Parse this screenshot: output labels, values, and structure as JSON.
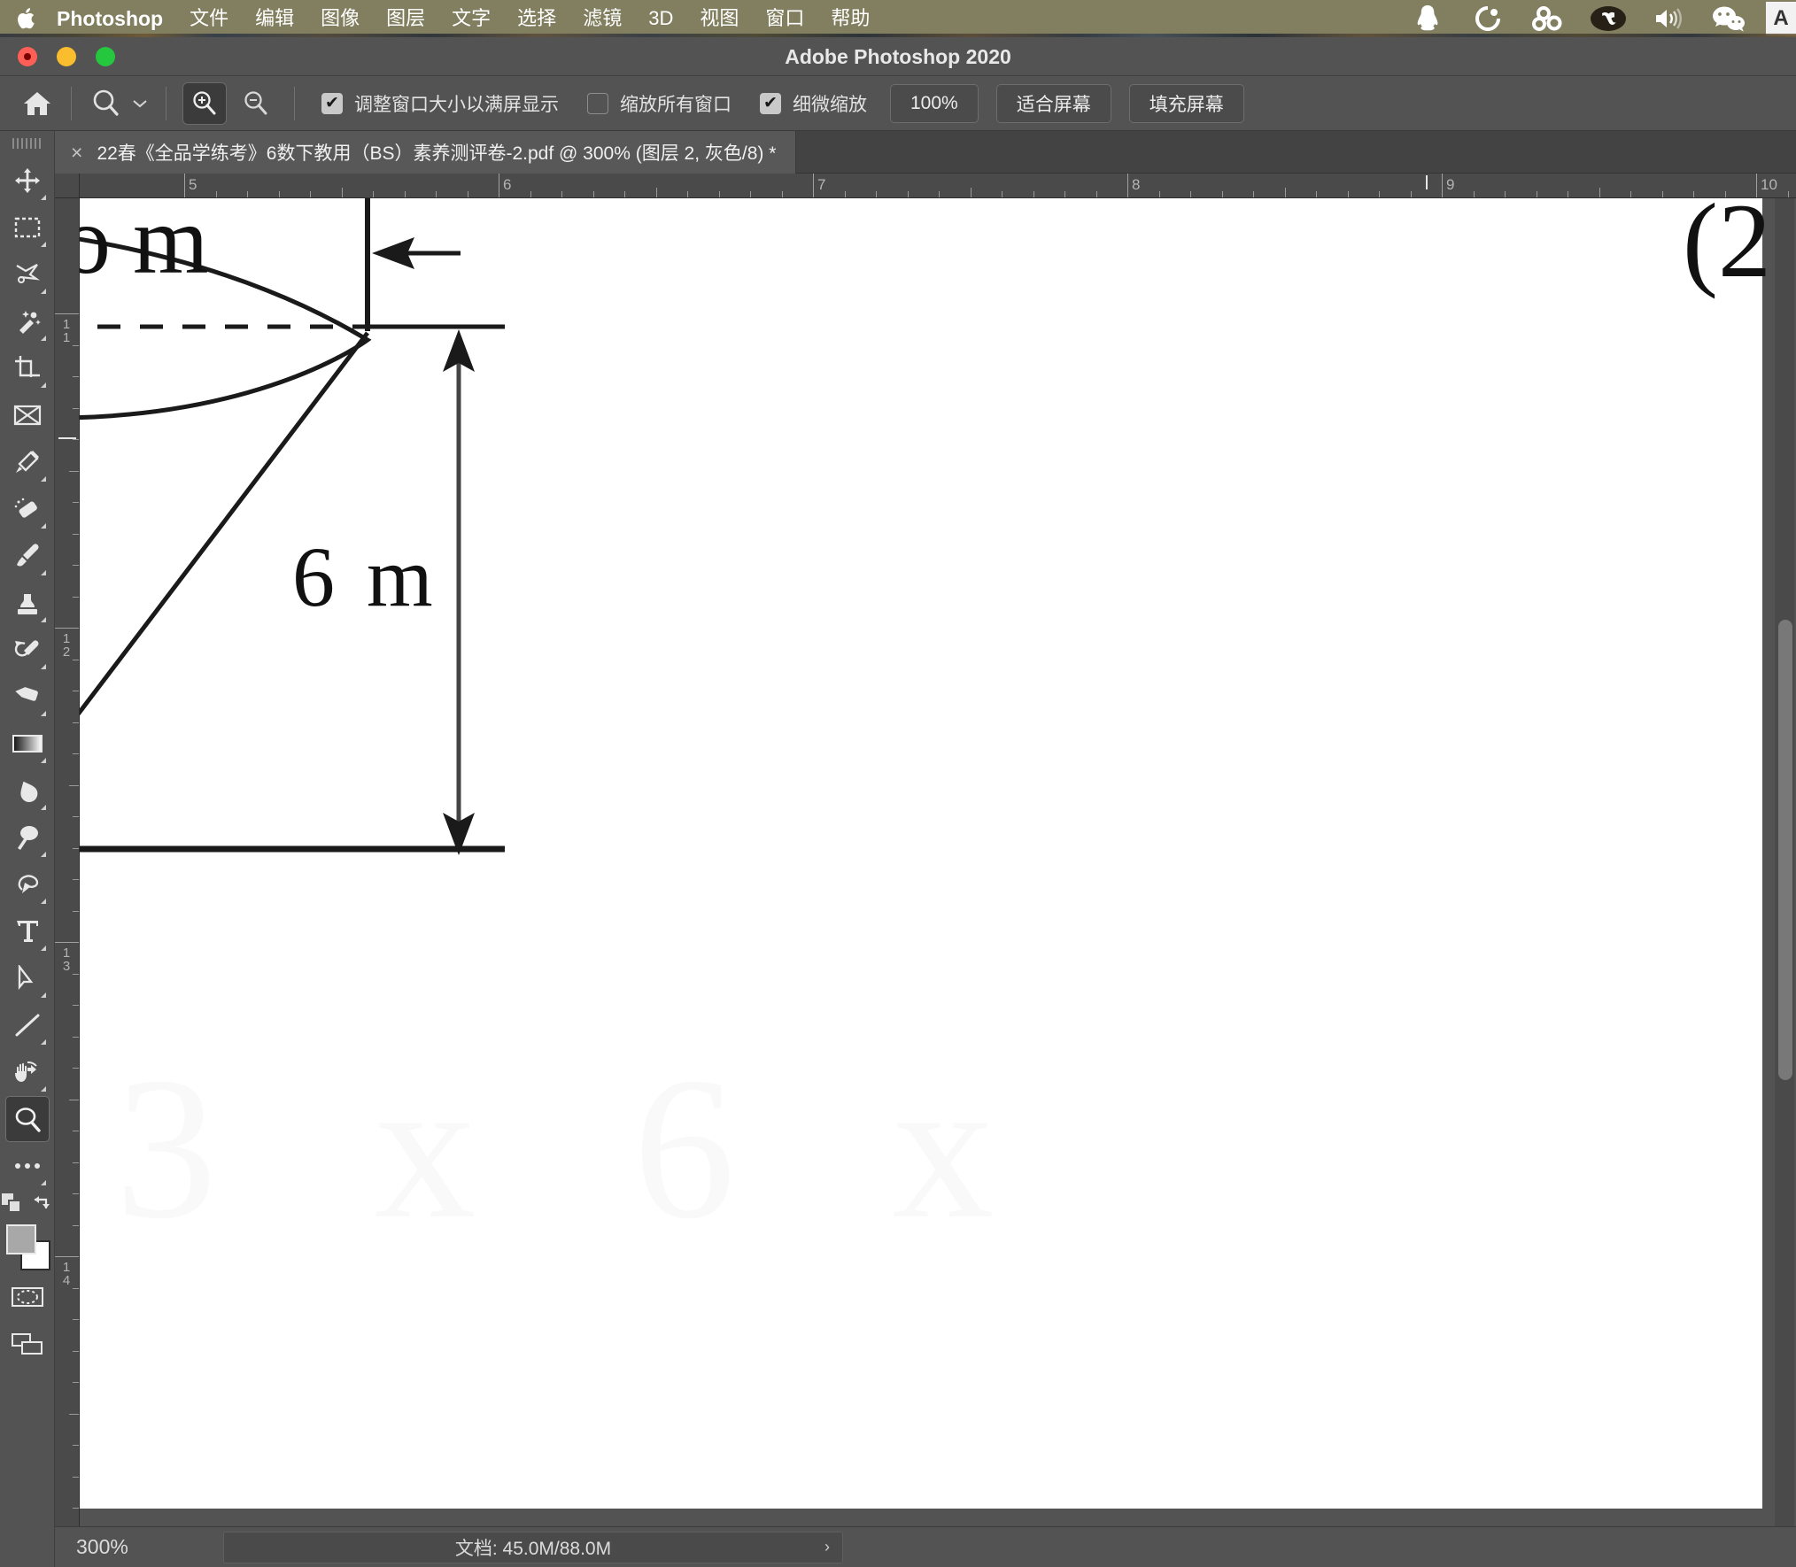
{
  "menubar": {
    "apple_icon": "apple-logo-icon",
    "brand": "Photoshop",
    "items": [
      "文件",
      "编辑",
      "图像",
      "图层",
      "文字",
      "选择",
      "滤镜",
      "3D",
      "视图",
      "窗口",
      "帮助"
    ],
    "status_icons": [
      "qq-penguin-icon",
      "circle-ring-icon",
      "bluetooth-rings-icon",
      "creative-cloud-icon",
      "volume-speaker-icon",
      "wechat-icon"
    ],
    "input_method_label": "A",
    "bar_color": "#817f5f"
  },
  "titlebar": {
    "title": "Adobe Photoshop 2020",
    "traffic_lights": [
      "close-button",
      "minimize-button",
      "maximize-button"
    ]
  },
  "optionsbar": {
    "home_icon": "home-icon",
    "tool_preset_icon": "zoom-tool-icon",
    "preset_chevron": "chevron-down-icon",
    "zoom_in_icon": "zoom-in-icon",
    "zoom_out_icon": "zoom-out-icon",
    "active_zoom_mode": "zoom-in",
    "checkboxes": [
      {
        "label": "调整窗口大小以满屏显示",
        "checked": true,
        "name": "resize-windows-to-fit"
      },
      {
        "label": "缩放所有窗口",
        "checked": false,
        "name": "zoom-all-windows"
      },
      {
        "label": "细微缩放",
        "checked": true,
        "name": "scrubby-zoom"
      }
    ],
    "buttons": [
      {
        "label": "100%",
        "name": "actual-pixels-button"
      },
      {
        "label": "适合屏幕",
        "name": "fit-screen-button"
      },
      {
        "label": "填充屏幕",
        "name": "fill-screen-button"
      }
    ]
  },
  "document_tab": {
    "close_glyph": "×",
    "title": "22春《全品学练考》6数下教用（BS）素养测评卷-2.pdf @ 300% (图层 2, 灰色/8) *"
  },
  "toolbar": {
    "tools": [
      {
        "name": "move-tool",
        "icon": "move-icon",
        "active": false,
        "corner": true
      },
      {
        "name": "marquee-tool",
        "icon": "rectangular-marquee-icon",
        "active": false,
        "corner": true
      },
      {
        "name": "lasso-tool",
        "icon": "lasso-icon",
        "active": false,
        "corner": true
      },
      {
        "name": "quick-selection-tool",
        "icon": "magic-wand-icon",
        "active": false,
        "corner": true
      },
      {
        "name": "crop-tool",
        "icon": "crop-icon",
        "active": false,
        "corner": true
      },
      {
        "name": "frame-tool",
        "icon": "frame-icon",
        "active": false,
        "corner": false
      },
      {
        "name": "eyedropper-tool",
        "icon": "eyedropper-icon",
        "active": false,
        "corner": true
      },
      {
        "name": "healing-brush-tool",
        "icon": "spot-healing-icon",
        "active": false,
        "corner": true
      },
      {
        "name": "brush-tool",
        "icon": "paintbrush-icon",
        "active": false,
        "corner": true
      },
      {
        "name": "clone-stamp-tool",
        "icon": "clone-stamp-icon",
        "active": false,
        "corner": true
      },
      {
        "name": "history-brush-tool",
        "icon": "history-brush-icon",
        "active": false,
        "corner": true
      },
      {
        "name": "eraser-tool",
        "icon": "eraser-icon",
        "active": false,
        "corner": true
      },
      {
        "name": "gradient-tool",
        "icon": "gradient-icon",
        "active": false,
        "corner": true
      },
      {
        "name": "blur-tool",
        "icon": "blur-drop-icon",
        "active": false,
        "corner": true
      },
      {
        "name": "dodge-tool",
        "icon": "dodge-icon",
        "active": false,
        "corner": true
      },
      {
        "name": "pen-tool",
        "icon": "pen-icon",
        "active": false,
        "corner": true
      },
      {
        "name": "type-tool",
        "icon": "type-T-icon",
        "active": false,
        "corner": true
      },
      {
        "name": "path-selection-tool",
        "icon": "path-arrow-icon",
        "active": false,
        "corner": true
      },
      {
        "name": "shape-tool",
        "icon": "line-shape-icon",
        "active": false,
        "corner": true
      },
      {
        "name": "hand-tool",
        "icon": "hand-icon",
        "active": false,
        "corner": true
      },
      {
        "name": "zoom-tool",
        "icon": "magnifier-icon",
        "active": true,
        "corner": false
      }
    ],
    "more_tools_icon": "ellipsis-icon",
    "edit_toolbar_corner": true,
    "default_colors_icon": "default-colors-icon",
    "swap_colors_icon": "swap-colors-icon",
    "foreground_color": "#a8a8a8",
    "background_color": "#ffffff",
    "quick_mask_icon": "quick-mask-icon",
    "screen_mode_icon": "screen-mode-icon"
  },
  "rulers": {
    "horizontal_labels": [
      "5",
      "6",
      "7",
      "8",
      "9",
      "10"
    ],
    "vertical_labels": [
      "11",
      "12",
      "13",
      "14"
    ],
    "guide_marker_near": "9",
    "unit": "cm"
  },
  "canvas": {
    "artwork_texts": [
      {
        "text": "m",
        "name": "cone-top-label-m"
      },
      {
        "text": "6 m",
        "name": "cone-height-label"
      },
      {
        "text": "(2",
        "name": "question-number-clipped"
      }
    ],
    "background": "#ffffff"
  },
  "statusbar": {
    "zoom_level": "300%",
    "doc_info": "文档: 45.0M/88.0M",
    "expand_glyph": "›"
  }
}
